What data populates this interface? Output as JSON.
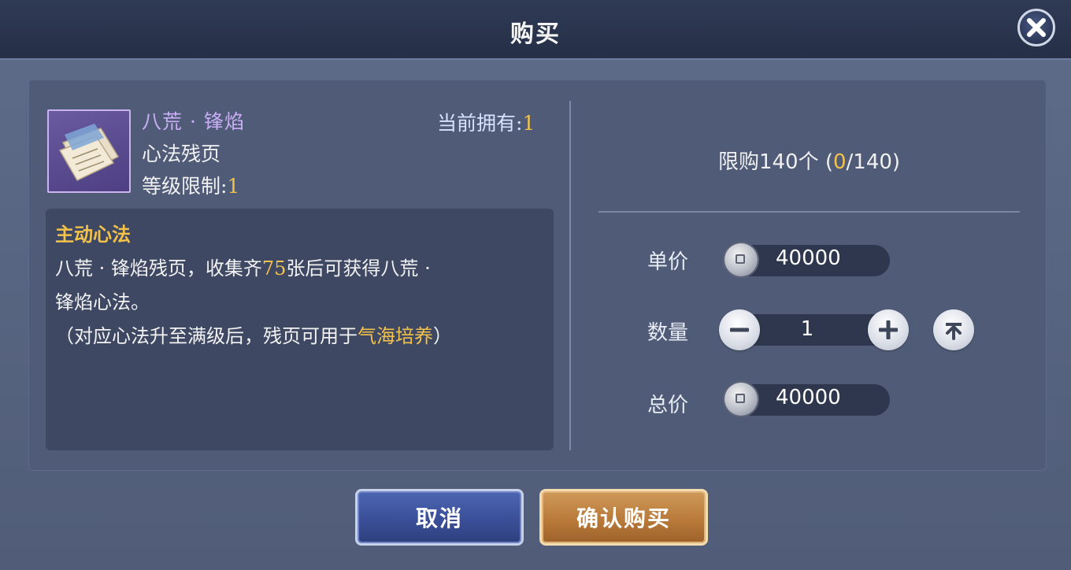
{
  "dialog": {
    "title": "购买",
    "close_icon": "close-icon"
  },
  "item": {
    "name": "八荒 · 锋焰",
    "type": "心法残页",
    "level_label": "等级限制:",
    "level_value": "1",
    "owned_label": "当前拥有:",
    "owned_value": "1",
    "icon": "scroll-pages-icon"
  },
  "description": {
    "title": "主动心法",
    "line1_a": "八荒 · 锋焰残页，收集齐",
    "line1_num": "75",
    "line1_b": "张后可获得八荒 ·",
    "line2": "锋焰心法。",
    "line3_a": "（对应心法升至满级后，残页可用于",
    "line3_highlight": "气海培养",
    "line3_b": "）"
  },
  "purchase": {
    "limit_prefix": "限购140个 (",
    "limit_current": "0",
    "limit_suffix": "/140)",
    "unit_price_label": "单价",
    "unit_price": "40000",
    "quantity_label": "数量",
    "quantity": "1",
    "total_label": "总价",
    "total_price": "40000"
  },
  "buttons": {
    "cancel": "取消",
    "confirm": "确认购买"
  },
  "colors": {
    "accent_gold": "#f3c24b",
    "item_name_purple": "#c9aef5"
  }
}
